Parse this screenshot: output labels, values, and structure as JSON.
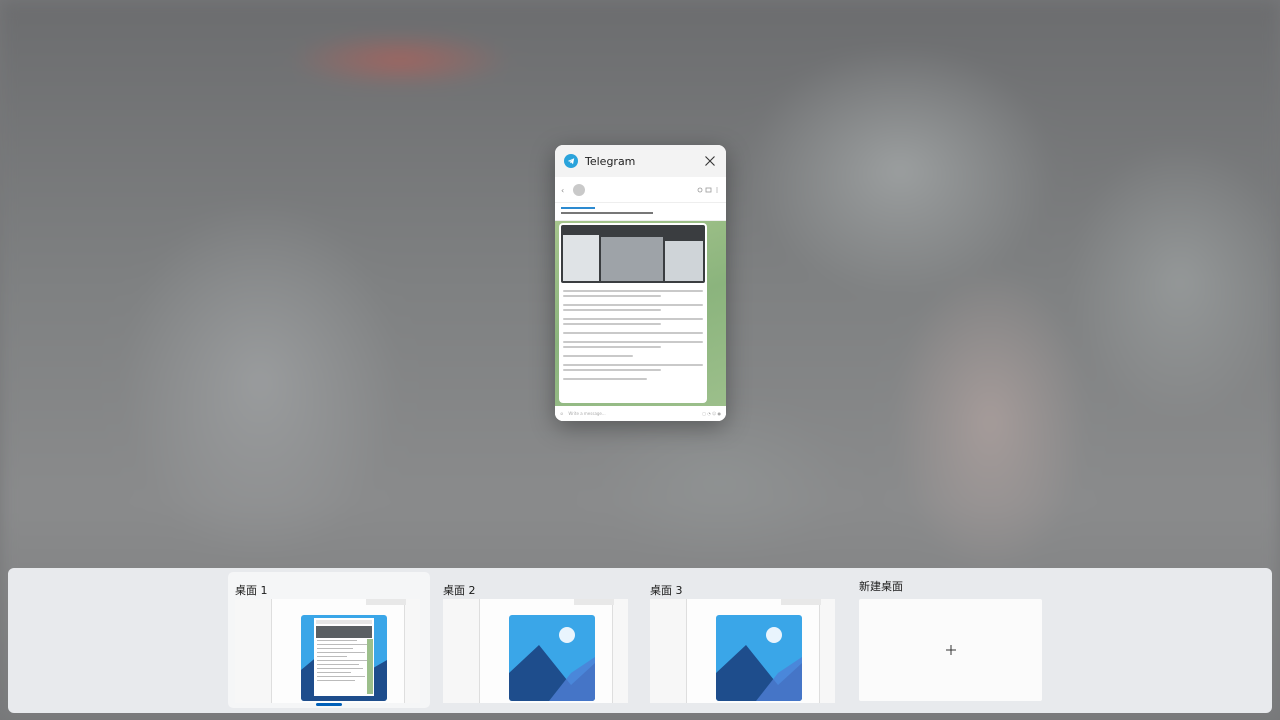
{
  "window_card": {
    "app_name": "Telegram",
    "icon": "telegram-icon",
    "close_icon": "close-icon",
    "input_placeholder": "Write a message..."
  },
  "desktops": [
    {
      "label": "桌面 1",
      "selected": true,
      "thumbnail": "desktop-with-telegram-window"
    },
    {
      "label": "桌面 2",
      "selected": false,
      "thumbnail": "wallpaper-icon"
    },
    {
      "label": "桌面 3",
      "selected": false,
      "thumbnail": "wallpaper-icon"
    }
  ],
  "new_desktop": {
    "label": "新建桌面",
    "icon": "plus-icon"
  },
  "colors": {
    "accent": "#005fb8",
    "telegram_blue": "#2aa3db",
    "wallpaper_sky": "#3aa6e8",
    "wallpaper_mountain": "#1e4d8c"
  }
}
